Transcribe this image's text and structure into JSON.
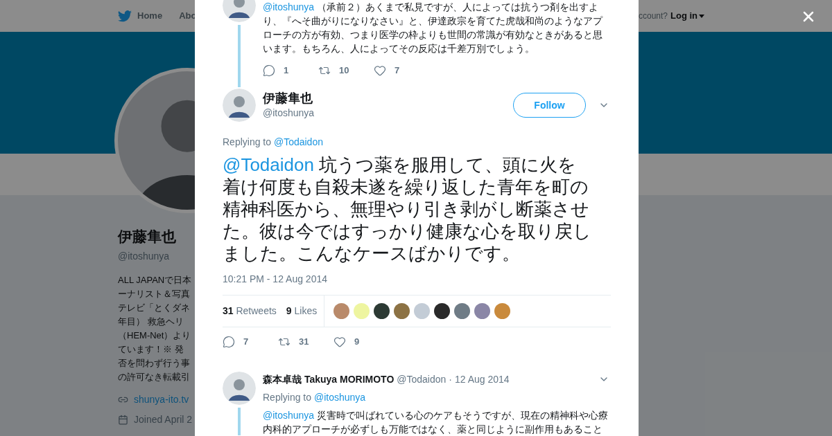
{
  "background_page": {
    "nav": {
      "items": [
        "Home",
        "Abo"
      ],
      "account_prompt": "ccount?",
      "login": "Log in"
    },
    "profile": {
      "name": "伊藤隼也",
      "handle": "@itoshunya",
      "bio_lines": [
        "ALL JAPANで日本",
        "ーナリスト＆写真",
        "テレビ「とくダネ",
        "年目） 救急ヘリ",
        "（HEM-Net）より",
        "ています！※ 発",
        "否を問わず行う事",
        "の許可なき転載引"
      ],
      "link": "shunya-ito.tv",
      "joined": "Joined April 2"
    }
  },
  "modal": {
    "thread_above": {
      "mention": "@itoshunya",
      "text": "（承前２）あくまで私見ですが、人によっては抗うつ剤を出すより、『へそ曲がりになりなさい』と、伊達政宗を育てた虎哉和尚のようなアプローチの方が有効、つまり医学の枠よりも世間の常識が有効なときがあると思います。もちろん、人によってその反応は千差万別でしょう。",
      "replies": "1",
      "retweets": "10",
      "likes": "7"
    },
    "main_tweet": {
      "name": "伊藤隼也",
      "handle": "@itoshunya",
      "follow": "Follow",
      "replying_label": "Replying to",
      "replying_to": "@Todaidon",
      "mention": "@Todaidon",
      "text": "坑うつ薬を服用して、頭に火を着け何度も自殺未遂を繰り返した青年を町の精神科医から、無理やり引き剥がし断薬させた。彼は今ではすっかり健康な心を取り戻しました。こんなケースばかりです。",
      "timestamp": "10:21 PM - 12 Aug 2014",
      "stats": [
        {
          "count": "31",
          "label": "Retweets"
        },
        {
          "count": "9",
          "label": "Likes"
        }
      ],
      "likers": [
        {
          "color": "#b98a6a"
        },
        {
          "color": "#eef5a0"
        },
        {
          "color": "#2c3a34"
        },
        {
          "color": "#8c7244"
        },
        {
          "color": "#c3ccd6"
        },
        {
          "color": "#2a2a2a"
        },
        {
          "color": "#6f7c86"
        },
        {
          "color": "#8a86a6"
        },
        {
          "color": "#c98a3c"
        }
      ],
      "replies": "7",
      "retweets": "31",
      "likes": "9"
    },
    "reply": {
      "name": "森本卓哉 Takuya MORIMOTO",
      "handle": "@Todaidon",
      "separator": "·",
      "date": "12 Aug 2014",
      "replying_label": "Replying to",
      "replying_to": "@itoshunya",
      "mention": "@itoshunya",
      "text": "災害時で叫ばれている心のケアもそうですが、現在の精神科や心療内科的アプローチが必ずしも万能ではなく、薬と同じように副作用もあること"
    }
  }
}
